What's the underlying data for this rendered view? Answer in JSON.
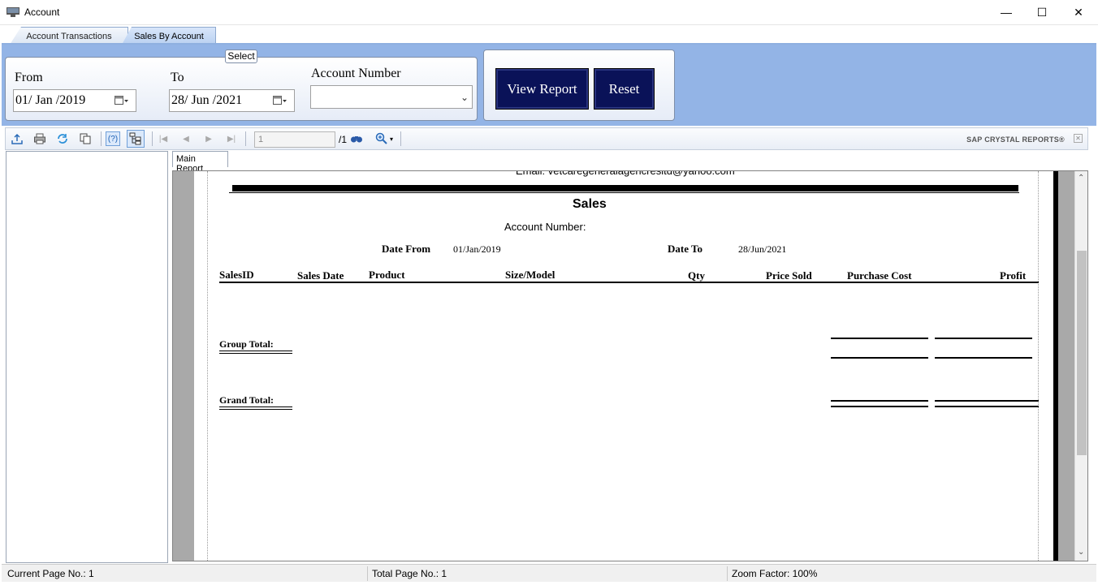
{
  "window": {
    "title": "Account",
    "minimize": "—",
    "maximize": "☐",
    "close": "✕"
  },
  "tabs": [
    {
      "label": "Account Transactions"
    },
    {
      "label": "Sales By Account"
    }
  ],
  "select_group": {
    "legend": "Select",
    "from_label": "From",
    "from_value": "01/ Jan /2019",
    "to_label": "To",
    "to_value": "28/ Jun /2021",
    "account_label": "Account Number",
    "account_value": ""
  },
  "buttons": {
    "view_report": "View Report",
    "reset": "Reset"
  },
  "viewer_toolbar": {
    "page_input": "1",
    "page_total": "/1",
    "brand": "SAP CRYSTAL REPORTS®",
    "icons": [
      "export-icon",
      "print-icon",
      "refresh-icon",
      "copy-icon",
      "help-icon",
      "group-tree-icon",
      "first-page-icon",
      "previous-page-icon",
      "next-page-icon",
      "last-page-icon",
      "find-icon",
      "zoom-icon"
    ]
  },
  "report": {
    "main_tab": "Main Report",
    "email_line": "Email: vetcaregeneralagencresltd@yahoo.com",
    "title": "Sales",
    "account_number_label": "Account Number:",
    "date_from_label": "Date From",
    "date_from_value": "01/Jan/2019",
    "date_to_label": "Date To",
    "date_to_value": "28/Jun/2021",
    "columns": [
      "SalesID",
      "Sales Date",
      "Product",
      "Size/Model",
      "Qty",
      "Price Sold",
      "Purchase Cost",
      "Profit"
    ],
    "group_total_label": "Group Total:",
    "grand_total_label": "Grand Total:"
  },
  "statusbar": {
    "current_page": "Current Page No.: 1",
    "total_page": "Total Page No.: 1",
    "zoom": "Zoom Factor: 100%"
  }
}
